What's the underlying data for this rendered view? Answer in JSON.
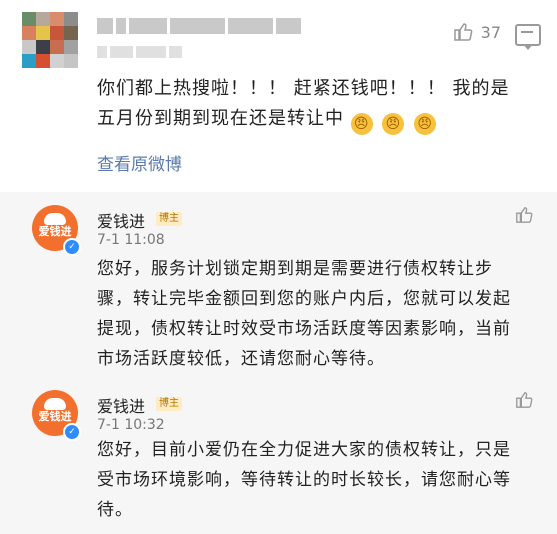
{
  "post": {
    "likes": "37",
    "text_line1": "你们都上热搜啦！！！ 赶紧还钱吧！！！ 我的是",
    "text_line2": "五月份到期到现在还是转让中",
    "view_original": "查看原微博"
  },
  "replies": [
    {
      "name": "爱钱进",
      "badge": "博主",
      "time": "7-1 11:08",
      "text": "您好，服务计划锁定期到期是需要进行债权转让步骤，转让完毕金额回到您的账户内后，您就可以发起提现，债权转让时效受市场活跃度等因素影响，当前市场活跃度较低，还请您耐心等待。"
    },
    {
      "name": "爱钱进",
      "badge": "博主",
      "time": "7-1 10:32",
      "text": "您好，目前小爱仍在全力促进大家的债权转让，只是受市场环境影响，等待转让的时长较长，请您耐心等待。"
    }
  ],
  "avatar": {
    "brand": "爱钱进"
  },
  "icons": {
    "like": "thumbs-up-icon",
    "comment": "comment-icon",
    "verified": "verified-badge-icon",
    "emoji": "angry-face-emoji"
  },
  "colors": {
    "link": "#5b7baa",
    "avatar_orange": "#f36f2d",
    "verified_blue": "#2f8cff",
    "reply_background": "#f6f6f6"
  }
}
